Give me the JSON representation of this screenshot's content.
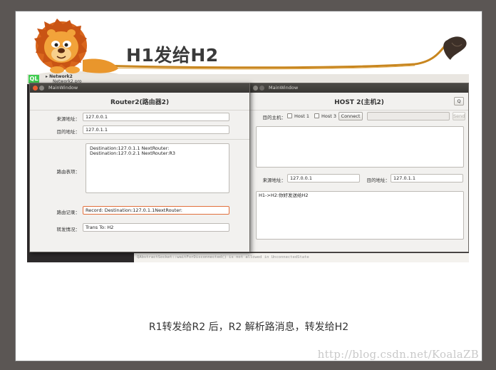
{
  "slide": {
    "title": "H1发给H2",
    "caption": "R1转发给R2 后，R2 解析路消息，转发给H2",
    "watermark": "http://blog.csdn.net/KoalaZB"
  },
  "desktop": {
    "qt_label": "QL",
    "tree_line1": "▸ Network2",
    "tree_line2": "Network2.pro",
    "console_text": "QAbstractSocket::waitForDisconnected() is not allowed in UnconnectedState"
  },
  "router_window": {
    "window_title": "MainWindow",
    "heading": "Router2(路由器2)",
    "source_label": "来源地址：",
    "source_value": "127.0.0.1",
    "dest_label": "目的地址：",
    "dest_value": "127.0.1.1",
    "table_label": "路由表项：",
    "table_rows": [
      "Destination:127.0.1.1  NextRouter:",
      "Destination:127.0.2.1  NextRouter:R3"
    ],
    "record_label": "路由记录：",
    "record_value": "Record:  Destination:127.0.1.1NextRouter:",
    "forward_label": "转发情况：",
    "forward_value": "Trans To: H2"
  },
  "host_window": {
    "window_title": "MainWindow",
    "heading": "HOST 2(主机2)",
    "q_button": "Q",
    "target_label": "目的主机：",
    "host1_label": "Host 1",
    "host3_label": "Host 3",
    "connect_label": "Connect",
    "send_label": "Send",
    "source_label": "来源地址：",
    "source_value": "127.0.0.1",
    "dest_label": "目的地址：",
    "dest_value": "127.0.1.1",
    "message_text": "H1->H2:你好发送给H2"
  },
  "colors": {
    "accent_orange": "#e2703c",
    "titlebar_dark": "#3a3835",
    "swoosh": "#c8861f"
  }
}
